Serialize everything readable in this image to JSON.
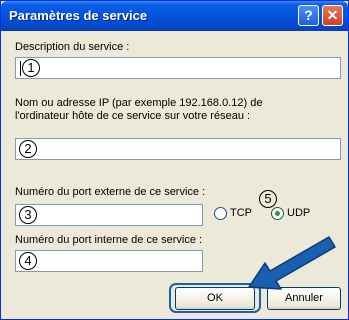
{
  "window": {
    "title": "Paramètres de service",
    "help_glyph": "?",
    "close_glyph": "✕"
  },
  "form": {
    "description_label": "Description du service :",
    "description_marker": "1",
    "address_label_line1": "Nom ou adresse IP (par exemple 192.168.0.12) de",
    "address_label_line2": "l'ordinateur hôte de ce service sur votre réseau :",
    "address_marker": "2",
    "external_port_label": "Numéro du port externe de ce service :",
    "external_port_marker": "3",
    "protocol_marker": "5",
    "protocol_options": [
      "TCP",
      "UDP"
    ],
    "protocol_selected": "UDP",
    "internal_port_label": "Numéro du port interne de ce service :",
    "internal_port_marker": "4"
  },
  "buttons": {
    "ok": "OK",
    "cancel": "Annuler"
  },
  "colors": {
    "titlebar": "#0453dd",
    "dialog_bg": "#ece9d8",
    "arrow": "#1a5fb0",
    "radio_selected": "#21a121"
  },
  "icons": {
    "help": "help-icon",
    "close": "close-icon",
    "pointer": "pointer-arrow-icon"
  }
}
